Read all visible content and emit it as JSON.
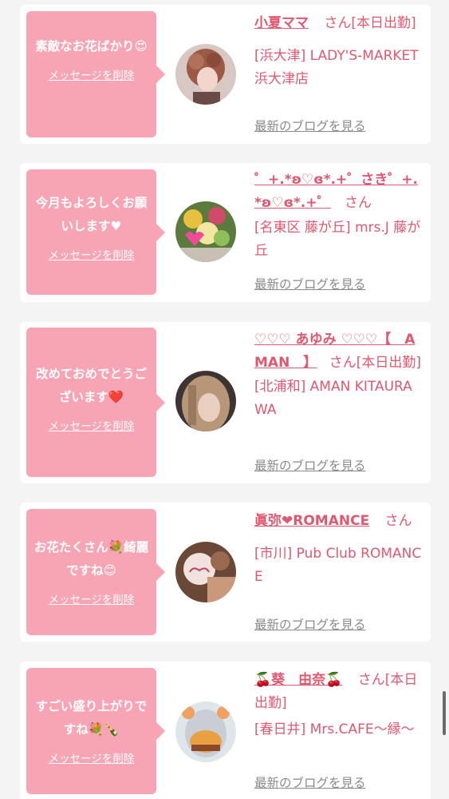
{
  "cards": [
    {
      "message": "素敵なお花ばかり😍",
      "delete_label": "メッセージを削除",
      "name": "小夏ママ",
      "san": "さん[本日出勤]",
      "shop": "[浜大津] LADY'S-MARKET 浜大津店",
      "blog_label": "最新のブログを見る"
    },
    {
      "message": "今月もよろしくお願いします♥",
      "delete_label": "メッセージを削除",
      "name": "゜+.*ʚ♡ɞ*.+゜さき゜+.*ʚ♡ɞ*.+゜",
      "san": "さん",
      "shop": "[名東区 藤が丘] mrs.J 藤が丘",
      "blog_label": "最新のブログを見る"
    },
    {
      "message": "改めておめでとうございます❤️",
      "delete_label": "メッセージを削除",
      "name": "♡♡♡ あゆみ ♡♡♡【　AMAN　】",
      "san": "さん[本日出勤]",
      "shop": "[北浦和] AMAN KITAURAWA",
      "blog_label": "最新のブログを見る"
    },
    {
      "message": "お花たくさん💐綺麗ですね😊",
      "delete_label": "メッセージを削除",
      "name": "眞弥❤ROMANCE",
      "san": "さん",
      "shop": "[市川] Pub Club ROMANCE",
      "blog_label": "最新のブログを見る"
    },
    {
      "message": "すごい盛り上がりですね💐🍾",
      "delete_label": "メッセージを削除",
      "name": "🍒葵　由奈🍒",
      "san": "さん[本日出勤]",
      "shop": "[春日井] Mrs.CAFE〜縁〜",
      "blog_label": "最新のブログを見る"
    }
  ],
  "colors": {
    "bubble": "#f7a4b4",
    "name": "#e05870",
    "muted": "#8a8a8a"
  }
}
